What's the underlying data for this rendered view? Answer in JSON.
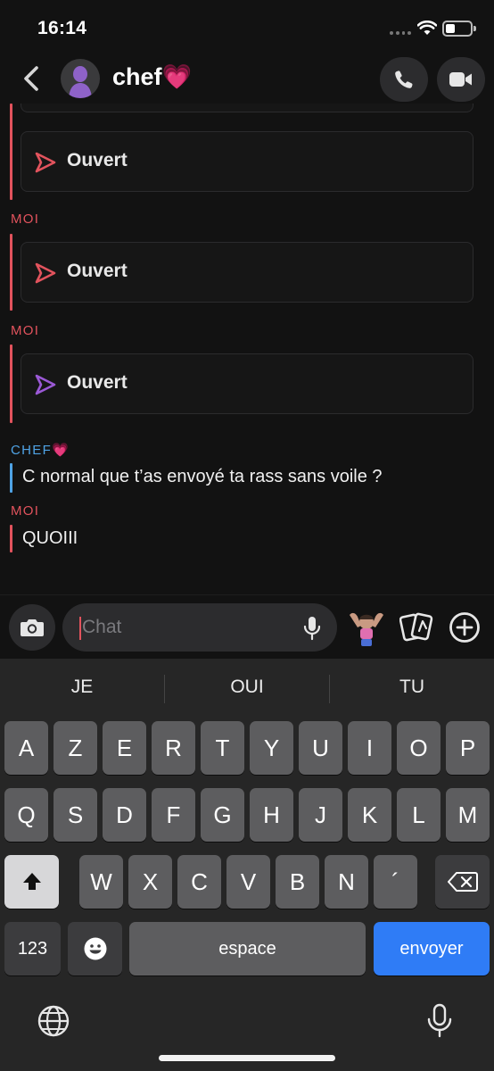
{
  "status_bar": {
    "time": "16:14"
  },
  "header": {
    "title": "chef💗"
  },
  "messages": {
    "snaps": [
      {
        "label": "Ouvert",
        "color": "#e2535d"
      },
      {
        "label": "Ouvert",
        "color": "#e2535d"
      },
      {
        "label": "Ouvert",
        "color": "#9b59d6"
      }
    ],
    "sender_me": "MOI",
    "sender_chef": "CHEF💗",
    "chef_text": "C normal que t’as envoyé ta rass sans voile ?",
    "me_text": "QUOIII"
  },
  "composer": {
    "placeholder": "Chat"
  },
  "keyboard": {
    "suggestions": [
      "JE",
      "OUI",
      "TU"
    ],
    "row1": [
      "A",
      "Z",
      "E",
      "R",
      "T",
      "Y",
      "U",
      "I",
      "O",
      "P"
    ],
    "row2": [
      "Q",
      "S",
      "D",
      "F",
      "G",
      "H",
      "J",
      "K",
      "L",
      "M"
    ],
    "row3": [
      "W",
      "X",
      "C",
      "V",
      "B",
      "N",
      "´"
    ],
    "numbers_label": "123",
    "space_label": "espace",
    "return_label": "envoyer"
  },
  "colors": {
    "me": "#e2535d",
    "chef": "#4fa3e5",
    "return_key": "#2f7cf6"
  },
  "icons": [
    "back-chevron-icon",
    "phone-icon",
    "video-camera-icon",
    "camera-icon",
    "microphone-icon",
    "bitmoji-icon",
    "cards-icon",
    "plus-circle-icon",
    "shift-icon",
    "backspace-icon",
    "emoji-icon",
    "globe-icon",
    "dictation-icon"
  ]
}
